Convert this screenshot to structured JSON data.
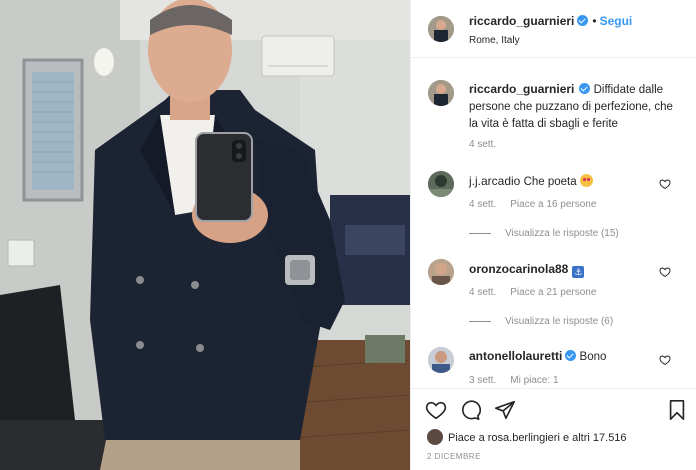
{
  "header": {
    "username": "riccardo_guarnieri",
    "follow_label": "Segui",
    "separator": "•",
    "location": "Rome, Italy"
  },
  "caption": {
    "username": "riccardo_guarnieri",
    "text": "Diffidate dalle persone che puzzano di perfezione, che la vita è fatta di sbagli e ferite",
    "time": "4 sett."
  },
  "comments": [
    {
      "username": "j.j.arcadio",
      "text": "Che poeta",
      "emoji": "star-struck-emoji",
      "time": "4 sett.",
      "likes": "Piace a 16 persone",
      "replies": "Visualizza le risposte (15)"
    },
    {
      "username": "oronzocarinola88",
      "text": "",
      "emoji": "anchor-emoji",
      "emoji_char": "⚓",
      "time": "4 sett.",
      "likes": "Piace a 21 persone",
      "replies": "Visualizza le risposte (6)"
    },
    {
      "username": "antonellolauretti",
      "text": "Bono",
      "verified": true,
      "time": "3 sett.",
      "likes": "Mi piace: 1"
    }
  ],
  "footer": {
    "liked_by": "Piace a rosa.berlingieri e altri 17.516",
    "date": "2 DICEMBRE"
  },
  "colors": {
    "accent": "#3897f0",
    "text": "#262626",
    "muted": "#8e8e8e",
    "border": "#efefef"
  }
}
